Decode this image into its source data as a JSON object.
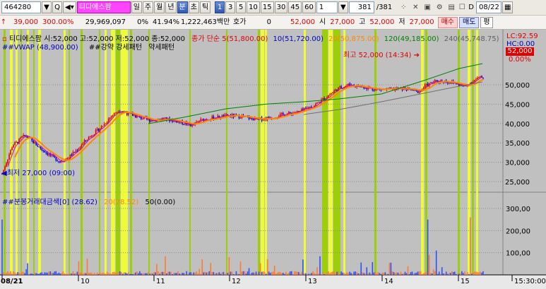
{
  "toolbar": {
    "code": "464280",
    "name": "티디에스팜",
    "periods": [
      "일",
      "주",
      "월",
      "년",
      "분",
      "초",
      "틱"
    ],
    "active_period": "분",
    "intervals": [
      "1",
      "3",
      "5",
      "10",
      "15",
      "30",
      "45",
      "60"
    ],
    "active_interval": "1",
    "interval_select": "1",
    "count": "381",
    "count_total": "/381",
    "date_check_label": "D",
    "date": "08/22"
  },
  "quote": {
    "change": "39,000",
    "change_pct": "300.00%",
    "volume": "29,969,097",
    "vol_pct": "0%",
    "turnover_pct": "41.94%",
    "amount": "1,222,463백만",
    "ask_label": "호가",
    "ask_val": "0",
    "price": "52,000",
    "open_label": "시",
    "open": "27,000",
    "high_label": "고",
    "high": "52,000",
    "low_label": "저",
    "low": "27,000",
    "buy": "매수",
    "sell": "매도",
    "eval": "평"
  },
  "price_legend": {
    "title": "티디에스팜",
    "ohlc": "시:52,000 고:52,000 저:52,000 종:52,000",
    "ma_label": "종가 단순",
    "ma5": "5(51,800.00)",
    "ma10": "10(51,720.00)",
    "ma20": "20(50,875.00)",
    "ma120": "120(49,185.00)",
    "ma240": "240(45,748.75)",
    "vwap": "##VWAP",
    "vwap_val": "(48,900.00)",
    "pattern_label": "##강약 강세패턴",
    "pattern_weak": "약세패턴",
    "lc": "LC:92.59",
    "hc": "HC:0.00",
    "last_price": "52,000",
    "last_pct": "0.00%"
  },
  "annotations": {
    "high": "최고 52,000 (14:34)",
    "low": "최저 27,000 (09:00)"
  },
  "volume_legend": {
    "title": "##분봉거래대금색[0]",
    "v1": "(28.62)",
    "v2": "20(28.52)",
    "v3": "50(0.00)"
  },
  "price_axis": [
    "50,000",
    "45,000",
    "40,000",
    "35,000",
    "30,000",
    "25,000"
  ],
  "volume_axis": [
    "300,00",
    "200,00",
    "100,00"
  ],
  "time_axis": [
    "08/21",
    "10",
    "11",
    "12",
    "13",
    "14",
    "15",
    "15:30:00"
  ],
  "colors": {
    "bg": "#c0c0c0",
    "up": "#e00000",
    "down": "#0000e0",
    "ma5": "#ff8800",
    "ma20": "#008000",
    "ma120": "#707070",
    "band_yellow": "#f0ff30",
    "band_green": "#9ad000"
  }
}
